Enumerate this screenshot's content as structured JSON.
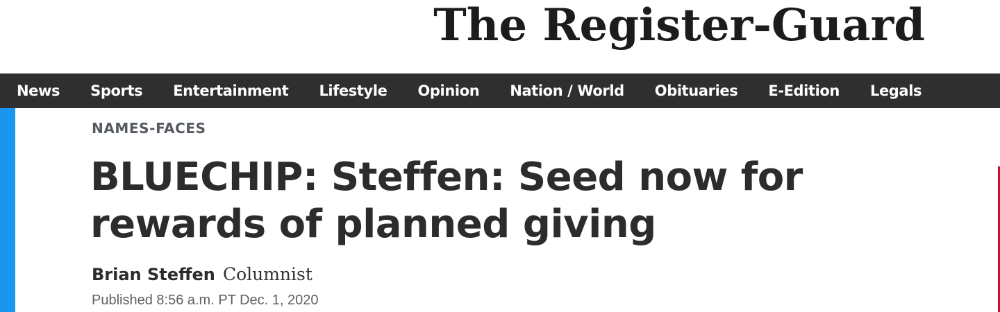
{
  "masthead": {
    "logo_text": "The Register-Guard"
  },
  "nav": {
    "items": [
      {
        "label": "News"
      },
      {
        "label": "Sports"
      },
      {
        "label": "Entertainment"
      },
      {
        "label": "Lifestyle"
      },
      {
        "label": "Opinion"
      },
      {
        "label": "Nation / World"
      },
      {
        "label": "Obituaries"
      },
      {
        "label": "E-Edition"
      },
      {
        "label": "Legals"
      }
    ]
  },
  "article": {
    "section": "NAMES-FACES",
    "headline": "BLUECHIP: Steffen: Seed now for rewards of planned giving",
    "author": "Brian Steffen",
    "author_role": "Columnist",
    "published": "Published 8:56 a.m. PT Dec. 1, 2020"
  },
  "colors": {
    "nav_background": "#2f2f2f",
    "accent_blue": "#1b96f0",
    "accent_red": "#c8102e",
    "headline_text": "#2c2c2c"
  }
}
